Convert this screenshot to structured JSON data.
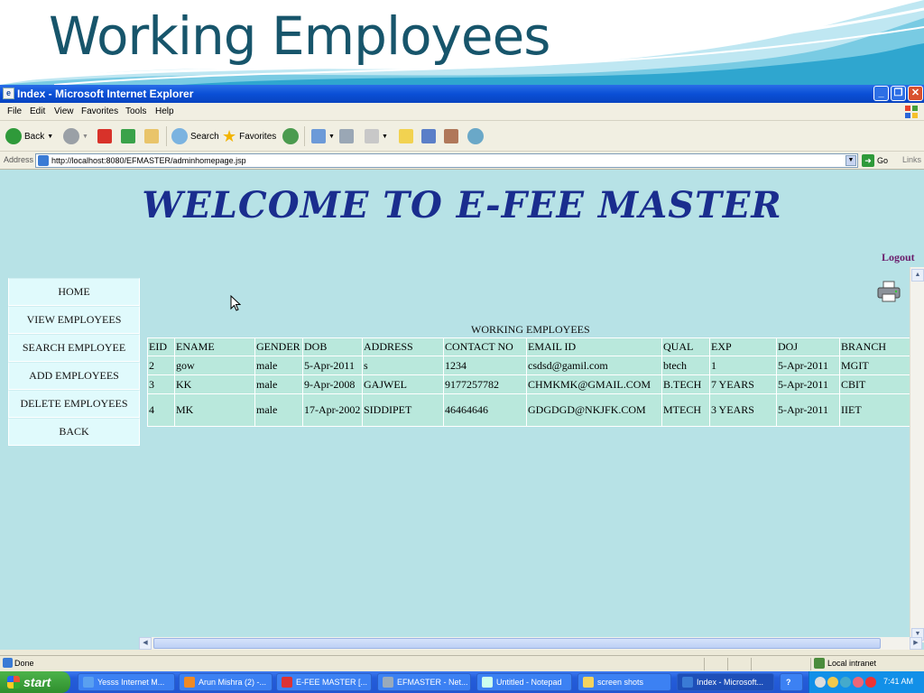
{
  "slide": {
    "title": "Working Employees"
  },
  "window": {
    "title": "Index - Microsoft Internet Explorer"
  },
  "menu": [
    "File",
    "Edit",
    "View",
    "Favorites",
    "Tools",
    "Help"
  ],
  "toolbar": {
    "back": "Back",
    "search": "Search",
    "favorites": "Favorites"
  },
  "address": {
    "label": "Address",
    "url": "http://localhost:8080/EFMASTER/adminhomepage.jsp",
    "go": "Go",
    "links": "Links"
  },
  "page": {
    "welcome": "WELCOME TO E-FEE MASTER",
    "logout": "Logout",
    "side_menu": [
      "HOME",
      "VIEW EMPLOYEES",
      "SEARCH EMPLOYEE",
      "ADD EMPLOYEES",
      "DELETE EMPLOYEES",
      "BACK"
    ],
    "table_caption": "WORKING EMPLOYEES",
    "table": {
      "headers": [
        "EID",
        "ENAME",
        "GENDER",
        "DOB",
        "ADDRESS",
        "CONTACT NO",
        "EMAIL ID",
        "QUAL",
        "EXP",
        "DOJ",
        "BRANCH"
      ],
      "rows": [
        [
          "2",
          "gow",
          "male",
          "5-Apr-2011",
          "s",
          "1234",
          "csdsd@gamil.com",
          "btech",
          "1",
          "5-Apr-2011",
          "MGIT"
        ],
        [
          "3",
          "KK",
          "male",
          "9-Apr-2008",
          "GAJWEL",
          "9177257782",
          "CHMKMK@GMAIL.COM",
          "B.TECH",
          "7 YEARS",
          "5-Apr-2011",
          "CBIT"
        ],
        [
          "4",
          "MK",
          "male",
          "17-Apr-2002",
          "SIDDIPET",
          "46464646",
          "GDGDGD@NKJFK.COM",
          "MTECH",
          "3 YEARS",
          "5-Apr-2011",
          "IIET"
        ]
      ]
    }
  },
  "status": {
    "text": "Done",
    "zone": "Local intranet"
  },
  "taskbar": {
    "start": "start",
    "tasks": [
      "Yesss Internet M...",
      "Arun Mishra (2) -...",
      "E-FEE MASTER [...",
      "EFMASTER - Net...",
      "Untitled - Notepad",
      "screen shots",
      "Index - Microsoft..."
    ],
    "clock": "7:41 AM"
  }
}
